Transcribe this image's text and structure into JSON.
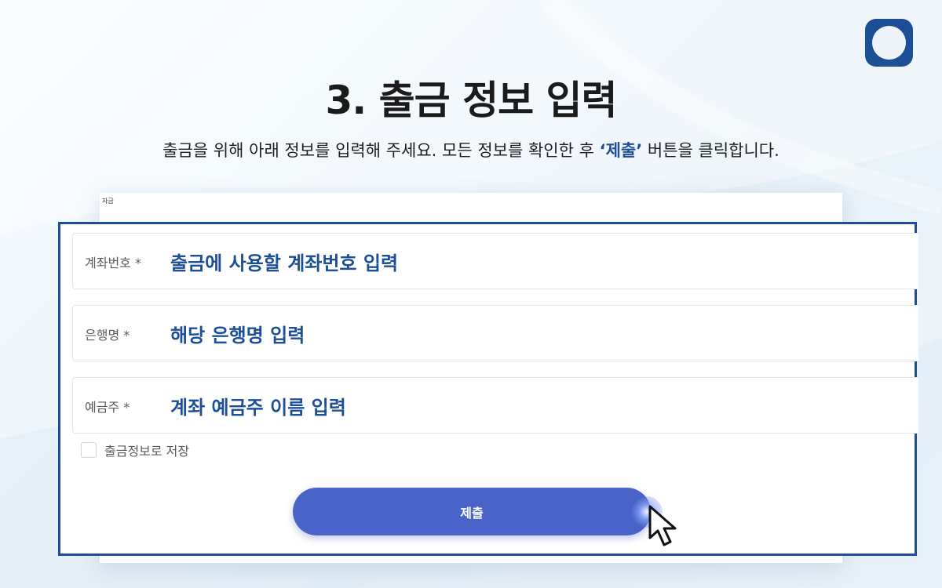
{
  "title": "3. 출금 정보 입력",
  "subtitle": {
    "before": "출금을 위해 아래 정보를 입력해 주세요. 모든 정보를 확인한 후 ",
    "accent": "‘제출’",
    "after": " 버튼을 클릭합니다."
  },
  "card_tiny_label": "자금",
  "fields": [
    {
      "label": "계좌번호 *",
      "value": "출금에 사용할 계좌번호 입력"
    },
    {
      "label": "은행명 *",
      "value": "해당 은행명 입력"
    },
    {
      "label": "예금주 *",
      "value": "계좌 예금주 이름 입력"
    }
  ],
  "save_checkbox": {
    "label": "출금정보로 저장",
    "checked": false
  },
  "submit_button": {
    "label": "제출"
  },
  "colors": {
    "accent": "#1d4f96",
    "button": "#4a63c8",
    "background": "#edf5fb"
  },
  "icons": [
    "app-logo-icon",
    "mouse-cursor-icon"
  ]
}
